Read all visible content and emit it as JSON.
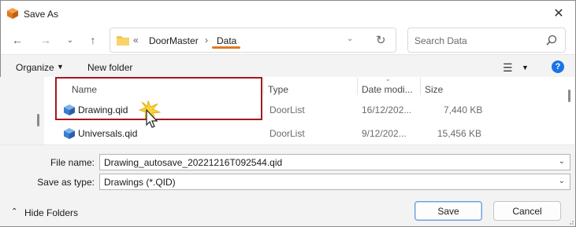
{
  "window": {
    "title": "Save As"
  },
  "nav": {
    "breadcrumb": [
      "DoorMaster",
      "Data"
    ],
    "search_placeholder": "Search Data"
  },
  "toolbar": {
    "organize": "Organize",
    "new_folder": "New folder"
  },
  "columns": {
    "name": "Name",
    "type": "Type",
    "date": "Date modi...",
    "size": "Size"
  },
  "files": [
    {
      "name": "Drawing.qid",
      "type": "DoorList",
      "date": "16/12/202...",
      "size": "7,440 KB"
    },
    {
      "name": "Universals.qid",
      "type": "DoorList",
      "date": "9/12/202...",
      "size": "15,456 KB"
    }
  ],
  "form": {
    "filename_label": "File name:",
    "filename_value": "Drawing_autosave_20221216T092544.qid",
    "savetype_label": "Save as type:",
    "savetype_value": "Drawings (*.QID)"
  },
  "footer": {
    "hide_folders": "Hide Folders",
    "save": "Save",
    "cancel": "Cancel"
  },
  "colors": {
    "accent": "#e07a1f",
    "highlight": "#a3191f",
    "help": "#1a73e8"
  }
}
